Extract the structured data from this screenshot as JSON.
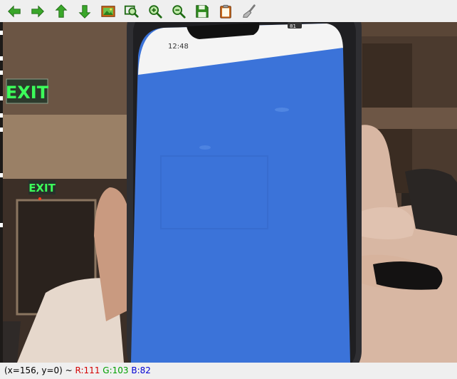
{
  "toolbar": {
    "buttons": [
      {
        "name": "pan-left-button",
        "icon": "arrow-left-icon"
      },
      {
        "name": "pan-right-button",
        "icon": "arrow-right-icon"
      },
      {
        "name": "pan-up-button",
        "icon": "arrow-up-icon"
      },
      {
        "name": "pan-down-button",
        "icon": "arrow-down-icon"
      },
      {
        "name": "zoom-fit-button",
        "icon": "image-icon"
      },
      {
        "name": "zoom-area-button",
        "icon": "zoom-rect-icon"
      },
      {
        "name": "zoom-in-button",
        "icon": "zoom-in-icon"
      },
      {
        "name": "zoom-out-button",
        "icon": "zoom-out-icon"
      },
      {
        "name": "save-button",
        "icon": "floppy-disk-icon"
      },
      {
        "name": "copy-button",
        "icon": "clipboard-icon"
      },
      {
        "name": "properties-button",
        "icon": "brush-icon"
      }
    ]
  },
  "image": {
    "exit_sign_1": "EXIT",
    "exit_sign_2": "EXIT",
    "phone_time": "12:48",
    "phone_battery": "81"
  },
  "status": {
    "coords": "(x=156, y=0) ~ ",
    "r_label": "R:111",
    "g_label": "G:103",
    "b_label": "B:82"
  },
  "colors": {
    "arrow_green": "#2e9e1e",
    "screen_blue": "#3b73d9",
    "exit_green": "#3cff5a"
  }
}
